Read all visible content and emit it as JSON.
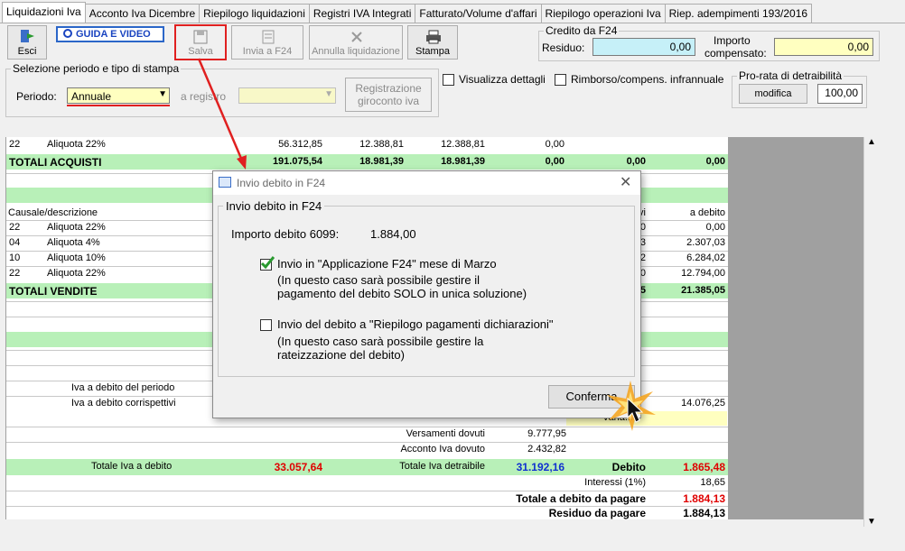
{
  "tabs": [
    "Liquidazioni Iva",
    "Acconto Iva Dicembre",
    "Riepilogo liquidazioni",
    "Registri IVA Integrati",
    "Fatturato/Volume d'affari",
    "Riepilogo operazioni Iva",
    "Riep. adempimenti 193/2016"
  ],
  "toolbar": {
    "esci": "Esci",
    "guida": "GUIDA E VIDEO",
    "salva": "Salva",
    "invia_f24": "Invia a F24",
    "annulla": "Annulla liquidazione",
    "stampa": "Stampa"
  },
  "credito": {
    "legend": "Credito da F24",
    "residuo_label": "Residuo:",
    "residuo_value": "0,00",
    "importo_label_1": "Importo",
    "importo_label_2": "compensato:",
    "importo_value": "0,00"
  },
  "selezione": {
    "legend": "Selezione periodo e tipo di stampa",
    "periodo_label": "Periodo:",
    "periodo_value": "Annuale",
    "registro_label": "a registro",
    "registrazione_1": "Registrazione",
    "registrazione_2": "giroconto iva"
  },
  "options": {
    "visualizza": "Visualizza dettagli",
    "rimborso": "Rimborso/compens. infrannuale",
    "prorata_legend": "Pro-rata di detraibilità",
    "modifica": "modifica",
    "prorata_value": "100,00"
  },
  "grid": {
    "row1": [
      "22",
      "Aliquota 22%",
      "56.312,85",
      "12.388,81",
      "12.388,81",
      "0,00"
    ],
    "totali_acquisti": [
      "TOTALI ACQUISTI",
      "191.075,54",
      "18.981,39",
      "18.981,39",
      "0,00",
      "0,00",
      "0,00"
    ],
    "header_left": "Causale/descrizione",
    "header_mid": "vi",
    "header_right": "a debito",
    "vendite": [
      {
        "code": "22",
        "desc": "Aliquota 22%",
        "mid": "0",
        "val": "0,00"
      },
      {
        "code": "04",
        "desc": "Aliquota 4%",
        "mid": "3",
        "val": "2.307,03"
      },
      {
        "code": "10",
        "desc": "Aliquota 10%",
        "mid": "2",
        "val": "6.284,02"
      },
      {
        "code": "22",
        "desc": "Aliquota 22%",
        "mid": "0",
        "val": "12.794,00"
      }
    ],
    "totali_vendite": [
      "TOTALI VENDITE",
      "5",
      "21.385,05"
    ],
    "iva_debito_periodo": "Iva a debito del periodo",
    "iva_debito_corrispettivi": "Iva a debito corrispettivi",
    "corrispettivi_value": "14.076,25",
    "varia_label": "Varia...",
    "versamenti_dovuti_label": "Versamenti dovuti",
    "versamenti_dovuti_value": "9.777,95",
    "acconto_label": "Acconto Iva dovuto",
    "acconto_value": "2.432,82",
    "totale_debito_label": "Totale Iva a debito",
    "totale_debito_value": "33.057,64",
    "totale_detraibile_label": "Totale Iva detraibile",
    "totale_detraibile_value": "31.192,16",
    "debito_label": "Debito",
    "debito_value": "1.865,48",
    "interessi_label": "Interessi (1%)",
    "interessi_value": "18,65",
    "totale_pagare_label": "Totale a debito da pagare",
    "totale_pagare_value": "1.884,13",
    "residuo_label": "Residuo da pagare",
    "residuo_value": "1.884,13"
  },
  "dialog": {
    "title": "Invio debito in F24",
    "group_title": "Invio debito in F24",
    "importo_label": "Importo debito 6099:",
    "importo_value": "1.884,00",
    "opt1_title": "Invio in \"Applicazione F24\" mese di Marzo",
    "opt1_note_1": "(In questo caso sarà possibile gestire il",
    "opt1_note_2": "pagamento del debito SOLO in unica soluzione)",
    "opt2_title": "Invio del debito a \"Riepilogo pagamenti dichiarazioni\"",
    "opt2_note_1": "(In questo caso sarà possibile gestire la",
    "opt2_note_2": "rateizzazione del debito)",
    "confirm": "Conferma"
  },
  "colors": {
    "accent_red": "#e02020",
    "green_row": "#b8f0b8",
    "input_blue": "#c6f0f8",
    "input_yellow": "#ffffc0",
    "value_red": "#e00000",
    "value_blue": "#1030d0"
  }
}
